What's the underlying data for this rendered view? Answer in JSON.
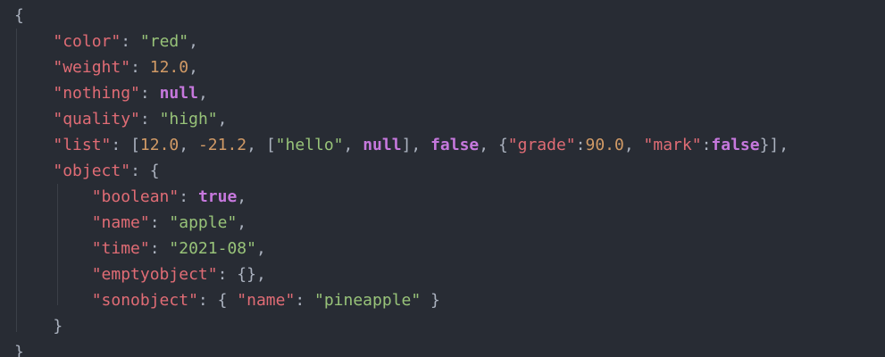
{
  "editor": {
    "lines": [
      [
        {
          "t": "{",
          "c": "p"
        }
      ],
      [
        {
          "t": "    ",
          "c": "p"
        },
        {
          "t": "\"color\"",
          "c": "k"
        },
        {
          "t": ": ",
          "c": "p"
        },
        {
          "t": "\"red\"",
          "c": "s"
        },
        {
          "t": ",",
          "c": "p"
        }
      ],
      [
        {
          "t": "    ",
          "c": "p"
        },
        {
          "t": "\"weight\"",
          "c": "k"
        },
        {
          "t": ": ",
          "c": "p"
        },
        {
          "t": "12.0",
          "c": "n"
        },
        {
          "t": ",",
          "c": "p"
        }
      ],
      [
        {
          "t": "    ",
          "c": "p"
        },
        {
          "t": "\"nothing\"",
          "c": "k"
        },
        {
          "t": ": ",
          "c": "p"
        },
        {
          "t": "null",
          "c": "b"
        },
        {
          "t": ",",
          "c": "p"
        }
      ],
      [
        {
          "t": "    ",
          "c": "p"
        },
        {
          "t": "\"quality\"",
          "c": "k"
        },
        {
          "t": ": ",
          "c": "p"
        },
        {
          "t": "\"high\"",
          "c": "s"
        },
        {
          "t": ",",
          "c": "p"
        }
      ],
      [
        {
          "t": "    ",
          "c": "p"
        },
        {
          "t": "\"list\"",
          "c": "k"
        },
        {
          "t": ": [",
          "c": "p"
        },
        {
          "t": "12.0",
          "c": "n"
        },
        {
          "t": ", ",
          "c": "p"
        },
        {
          "t": "-21.2",
          "c": "n"
        },
        {
          "t": ", [",
          "c": "p"
        },
        {
          "t": "\"hello\"",
          "c": "s"
        },
        {
          "t": ", ",
          "c": "p"
        },
        {
          "t": "null",
          "c": "b"
        },
        {
          "t": "], ",
          "c": "p"
        },
        {
          "t": "false",
          "c": "b"
        },
        {
          "t": ", {",
          "c": "p"
        },
        {
          "t": "\"grade\"",
          "c": "k"
        },
        {
          "t": ":",
          "c": "p"
        },
        {
          "t": "90.0",
          "c": "n"
        },
        {
          "t": ", ",
          "c": "p"
        },
        {
          "t": "\"mark\"",
          "c": "k"
        },
        {
          "t": ":",
          "c": "p"
        },
        {
          "t": "false",
          "c": "b"
        },
        {
          "t": "}],",
          "c": "p"
        }
      ],
      [
        {
          "t": "    ",
          "c": "p"
        },
        {
          "t": "\"object\"",
          "c": "k"
        },
        {
          "t": ": {",
          "c": "p"
        }
      ],
      [
        {
          "t": "        ",
          "c": "p"
        },
        {
          "t": "\"boolean\"",
          "c": "k"
        },
        {
          "t": ": ",
          "c": "p"
        },
        {
          "t": "true",
          "c": "b"
        },
        {
          "t": ",",
          "c": "p"
        }
      ],
      [
        {
          "t": "        ",
          "c": "p"
        },
        {
          "t": "\"name\"",
          "c": "k"
        },
        {
          "t": ": ",
          "c": "p"
        },
        {
          "t": "\"apple\"",
          "c": "s"
        },
        {
          "t": ",",
          "c": "p"
        }
      ],
      [
        {
          "t": "        ",
          "c": "p"
        },
        {
          "t": "\"time\"",
          "c": "k"
        },
        {
          "t": ": ",
          "c": "p"
        },
        {
          "t": "\"2021-08\"",
          "c": "s"
        },
        {
          "t": ",",
          "c": "p"
        }
      ],
      [
        {
          "t": "        ",
          "c": "p"
        },
        {
          "t": "\"emptyobject\"",
          "c": "k"
        },
        {
          "t": ": {},",
          "c": "p"
        }
      ],
      [
        {
          "t": "        ",
          "c": "p"
        },
        {
          "t": "\"sonobject\"",
          "c": "k"
        },
        {
          "t": ": { ",
          "c": "p"
        },
        {
          "t": "\"name\"",
          "c": "k"
        },
        {
          "t": ": ",
          "c": "p"
        },
        {
          "t": "\"pineapple\"",
          "c": "s"
        },
        {
          "t": " }",
          "c": "p"
        }
      ],
      [
        {
          "t": "    ",
          "c": "p"
        },
        {
          "t": "}",
          "c": "p"
        }
      ],
      [
        {
          "t": "}",
          "c": "p"
        }
      ]
    ]
  },
  "colors": {
    "background": "#282c34",
    "key": "#e06c75",
    "string": "#98c379",
    "number": "#d19a66",
    "literal": "#c678dd",
    "punctuation": "#abb2bf"
  }
}
